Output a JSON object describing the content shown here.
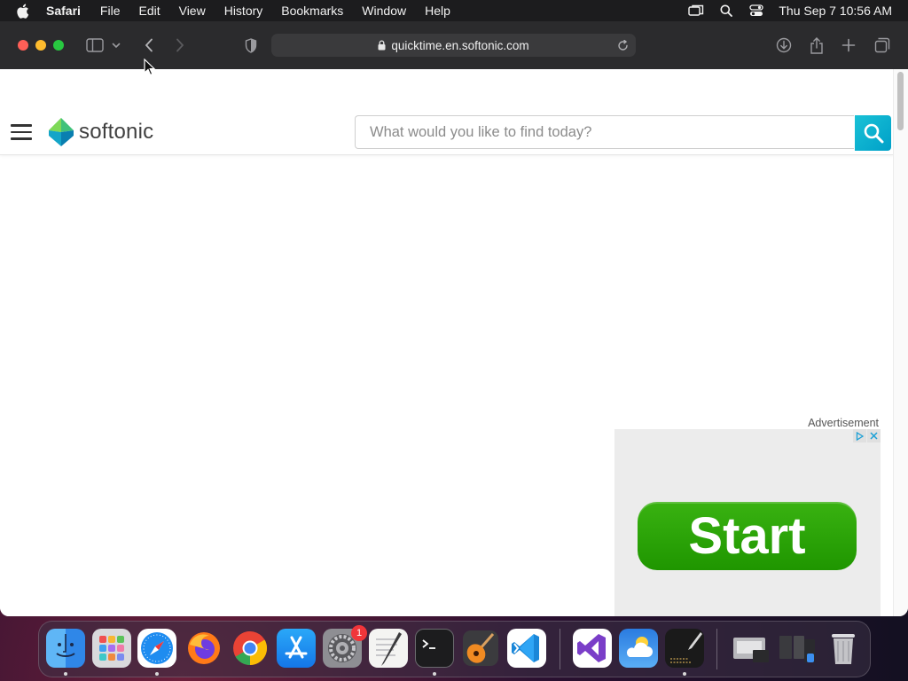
{
  "menubar": {
    "app_name": "Safari",
    "items": [
      "File",
      "Edit",
      "View",
      "History",
      "Bookmarks",
      "Window",
      "Help"
    ],
    "clock": "Thu Sep 7  10:56 AM"
  },
  "browser": {
    "url": "quicktime.en.softonic.com"
  },
  "site": {
    "logo_text": "softonic",
    "search_placeholder": "What would you like to find today?"
  },
  "ad": {
    "label": "Advertisement",
    "button_label": "Start"
  },
  "dock": {
    "apps": [
      "Finder",
      "Launchpad",
      "Safari",
      "Firefox",
      "Chrome",
      "App Store",
      "System Preferences",
      "TextEdit",
      "Terminal",
      "GarageBand",
      "Visual Studio Code",
      "Visual Studio",
      "Weather",
      "Script Editor",
      "Downloads Stack",
      "Recent Items",
      "Trash"
    ],
    "settings_badge": "1"
  },
  "colors": {
    "search_button": "#00a0c8",
    "ad_button": "#2ea40a",
    "menubar": "#1c1c1e",
    "toolbar": "#2b2b2d"
  }
}
